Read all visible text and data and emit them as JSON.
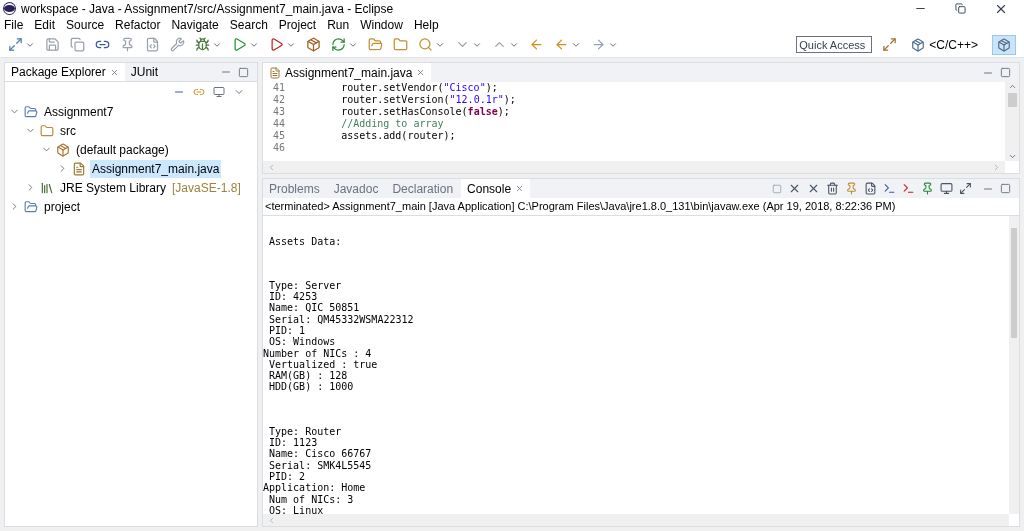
{
  "window": {
    "title": "workspace - Java - Assignment7/src/Assignment7_main.java - Eclipse"
  },
  "menu": [
    "File",
    "Edit",
    "Source",
    "Refactor",
    "Navigate",
    "Search",
    "Project",
    "Run",
    "Window",
    "Help"
  ],
  "quick_access": {
    "placeholder": "Quick Access"
  },
  "perspectives": [
    {
      "label": "<C/C++>",
      "selected": false
    },
    {
      "selected": true
    }
  ],
  "explorer": {
    "tabs": [
      {
        "label": "Package Explorer",
        "selected": true,
        "closable": true
      },
      {
        "label": "JUnit",
        "selected": false,
        "closable": false
      }
    ],
    "tree": [
      {
        "label": "Assignment7",
        "kind": "project",
        "expanded": true,
        "selected": false,
        "children": [
          {
            "label": "src",
            "kind": "folder",
            "expanded": true,
            "selected": false,
            "children": [
              {
                "label": "(default package)",
                "kind": "package",
                "expanded": true,
                "selected": false,
                "children": [
                  {
                    "label": "Assignment7_main.java",
                    "kind": "file",
                    "expanded": false,
                    "selected": true
                  }
                ]
              }
            ]
          },
          {
            "label": "JRE System Library",
            "decoration": "[JavaSE-1.8]",
            "kind": "library",
            "expanded": false,
            "selected": false
          }
        ]
      },
      {
        "label": "project",
        "kind": "project",
        "expanded": false,
        "selected": false
      }
    ]
  },
  "editor": {
    "tab": "Assignment7_main.java",
    "lines": [
      {
        "number": "41",
        "tokens": [
          {
            "text": "        router.setVendor(",
            "kind": "plain"
          },
          {
            "text": "\"Cisco\"",
            "kind": "string"
          },
          {
            "text": ");",
            "kind": "plain"
          }
        ]
      },
      {
        "number": "42",
        "tokens": [
          {
            "text": "        router.setVersion(",
            "kind": "plain"
          },
          {
            "text": "\"12.0.1r\"",
            "kind": "string"
          },
          {
            "text": ");",
            "kind": "plain"
          }
        ]
      },
      {
        "number": "43",
        "tokens": [
          {
            "text": "        router.setHasConsole(",
            "kind": "plain"
          },
          {
            "text": "false",
            "kind": "keyword"
          },
          {
            "text": ");",
            "kind": "plain"
          }
        ]
      },
      {
        "number": "44",
        "tokens": [
          {
            "text": "        //Adding to array",
            "kind": "comment"
          }
        ]
      },
      {
        "number": "45",
        "tokens": [
          {
            "text": "        assets.add(router);",
            "kind": "plain"
          }
        ]
      },
      {
        "number": "46"
      }
    ]
  },
  "console": {
    "tabs": [
      {
        "label": "Problems",
        "selected": false
      },
      {
        "label": "Javadoc",
        "selected": false
      },
      {
        "label": "Declaration",
        "selected": false
      },
      {
        "label": "Console",
        "selected": true
      }
    ],
    "status": "<terminated> Assignment7_main [Java Application] C:\\Program Files\\Java\\jre1.8.0_131\\bin\\javaw.exe (Apr 19, 2018, 8:22:36 PM)",
    "blocks": [
      {
        "lines": [
          " Assets Data:"
        ]
      },
      {
        "lines": [
          " Type: Server",
          " ID: 4253",
          " Name: QIC 50851",
          " Serial: QM45332WSMA22312",
          " PID: 1",
          " OS: Windows",
          "Number of NICs : 4",
          " Vertualized : true",
          " RAM(GB) : 128",
          " HDD(GB) : 1000"
        ]
      },
      {
        "lines": [
          " Type: Router",
          " ID: 1123",
          " Name: Cisco 66767",
          " Serial: SMK4L5545",
          " PID: 2",
          "Application: Home",
          " Num of NICs: 3",
          " OS: Linux"
        ]
      }
    ]
  }
}
